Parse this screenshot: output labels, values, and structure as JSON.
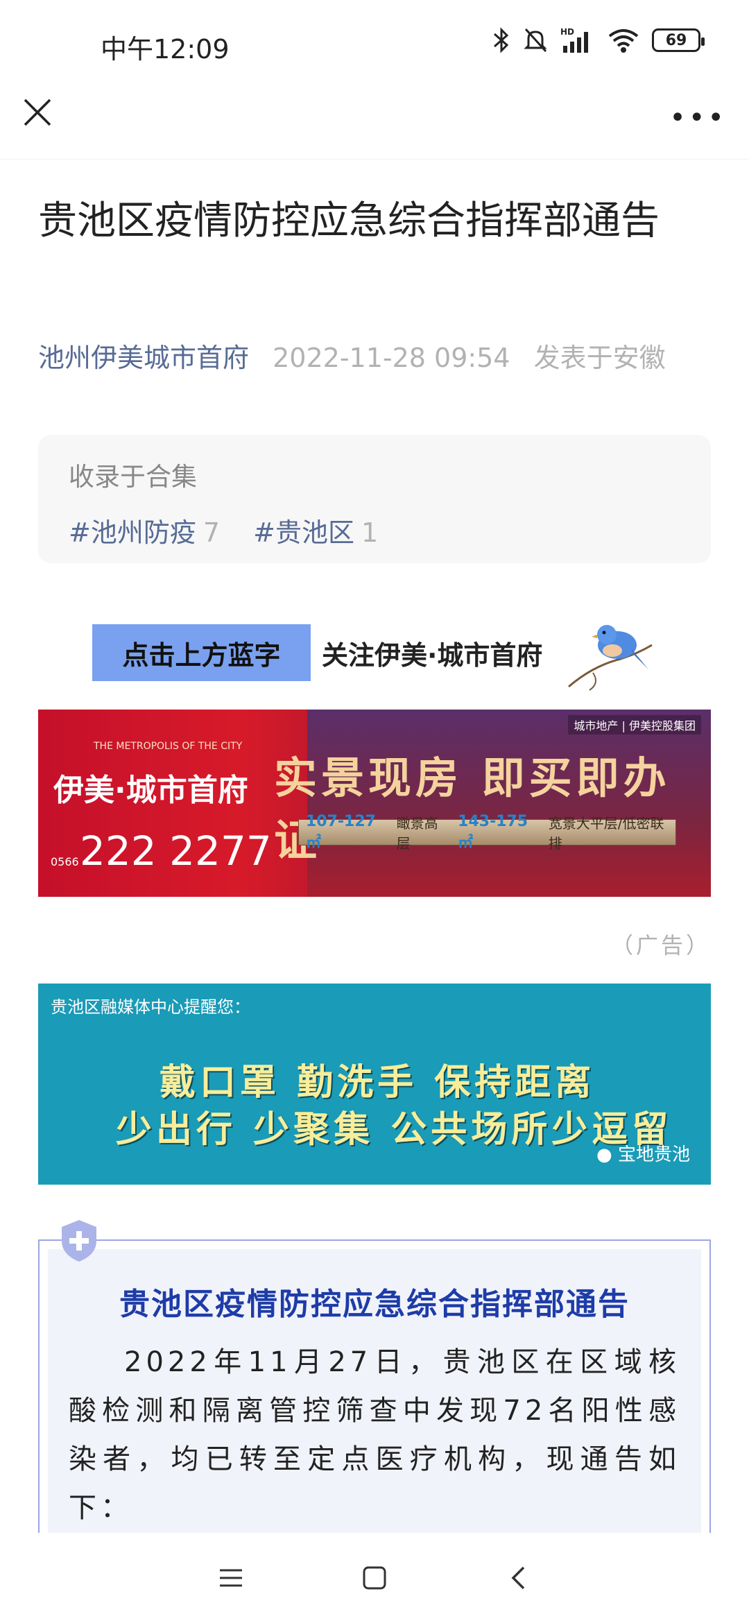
{
  "status_bar": {
    "time": "中午12:09",
    "battery": "69",
    "icons": [
      "bluetooth-icon",
      "mute-icon",
      "hd-signal-icon",
      "wifi-icon",
      "battery-icon"
    ]
  },
  "nav": {
    "close_icon": "close-icon",
    "more_icon": "more-icon",
    "more_glyph": "•••"
  },
  "article": {
    "title": "贵池区疫情防控应急综合指挥部通告",
    "author": "池州伊美城市首府",
    "date": "2022-11-28 09:54",
    "location": "发表于安徽"
  },
  "collection": {
    "label": "收录于合集",
    "tags": [
      {
        "name": "#池州防疫",
        "count": "7"
      },
      {
        "name": "#贵池区",
        "count": "1"
      }
    ]
  },
  "follow": {
    "button": "点击上方蓝字",
    "text": "关注伊美·城市首府"
  },
  "ad_banner": {
    "brand": "伊美·城市首府",
    "brand_sub": "THE METROPOLIS OF THE CITY",
    "phone_prefix": "0566",
    "phone": "222 2277",
    "slogan": "实景现房 即买即办证",
    "plate_a": "107-127㎡",
    "plate_a_txt": "瞰景高层",
    "plate_b": "143-175㎡",
    "plate_b_txt": "宽景大平层/低密联排",
    "logo": "城市地产 | 伊美控股集团",
    "ad_label": "（广告）"
  },
  "notice_banner": {
    "hint": "贵池区融媒体中心提醒您：",
    "line1": "戴口罩  勤洗手  保持距离",
    "line2": "少出行  少聚集  公共场所少逗留",
    "wechat": "宝地贵池"
  },
  "card": {
    "heading": "贵池区疫情防控应急综合指挥部通告",
    "paragraph": "2022年11月27日，贵池区在区域核酸检测和隔离管控筛查中发现72名阳性感染者，均已转至定点医疗机构，现通告如下："
  },
  "bottom_nav": {
    "icons": [
      "menu-icon",
      "home-icon",
      "back-icon"
    ]
  },
  "colors": {
    "link": "#576b95",
    "follow_btn": "#7aa1ef",
    "card_heading": "#1e3ca8",
    "notice_bg": "#1a9bb7"
  }
}
